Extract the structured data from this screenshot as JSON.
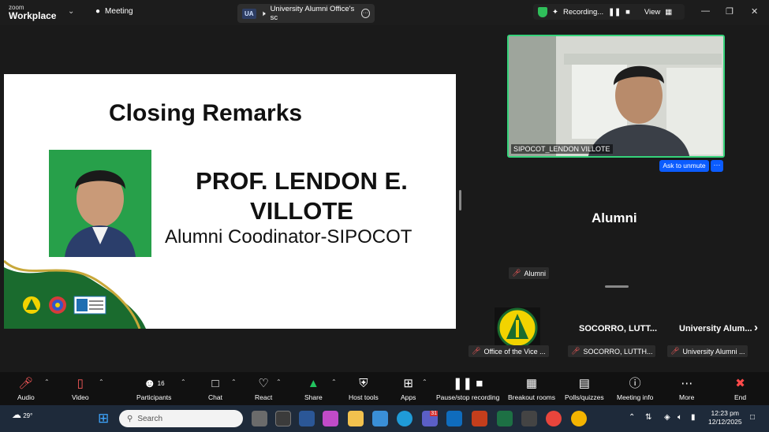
{
  "titlebar": {
    "brand_small": "zoom",
    "brand_large": "Workplace",
    "meeting_label": "Meeting",
    "tab_badge": "UA",
    "tab_title": "University Alumni Office's sc",
    "recording_label": "Recording...",
    "view_label": "View"
  },
  "slide": {
    "title": "Closing Remarks",
    "name_line1": "PROF. LENDON E.",
    "name_line2": "VILLOTE",
    "role": "Alumni Coodinator-SIPOCOT"
  },
  "video": {
    "name": "SIPOCOT_LENDON VILLOTE",
    "ask_to_unmute": "Ask to unmute",
    "more": "···"
  },
  "participants": {
    "alumni_large": "Alumni",
    "alumni_chip": "Alumni",
    "thumb_names": [
      "SOCORRO,  LUTT...",
      "University  Alum..."
    ],
    "chips": [
      "Office of the Vice ...",
      "SOCORRO, LUTTH...",
      "University Alumni ..."
    ]
  },
  "toolbar": {
    "audio": "Audio",
    "video": "Video",
    "participants": "Participants",
    "participants_count": "16",
    "chat": "Chat",
    "react": "React",
    "share": "Share",
    "host_tools": "Host tools",
    "apps": "Apps",
    "pause_recording": "Pause/stop recording",
    "breakout": "Breakout rooms",
    "polls": "Polls/quizzes",
    "meeting_info": "Meeting info",
    "more": "More",
    "end": "End"
  },
  "taskbar": {
    "weather": "29°",
    "search_placeholder": "Search",
    "time": "12:23 pm",
    "date": "12/12/2025",
    "badge_count": "31"
  },
  "colors": {
    "accent_blue": "#0b5cff",
    "speaker_green": "#35d37a",
    "mute_red": "#ff5b5b",
    "slide_green": "#1a6b2e"
  }
}
